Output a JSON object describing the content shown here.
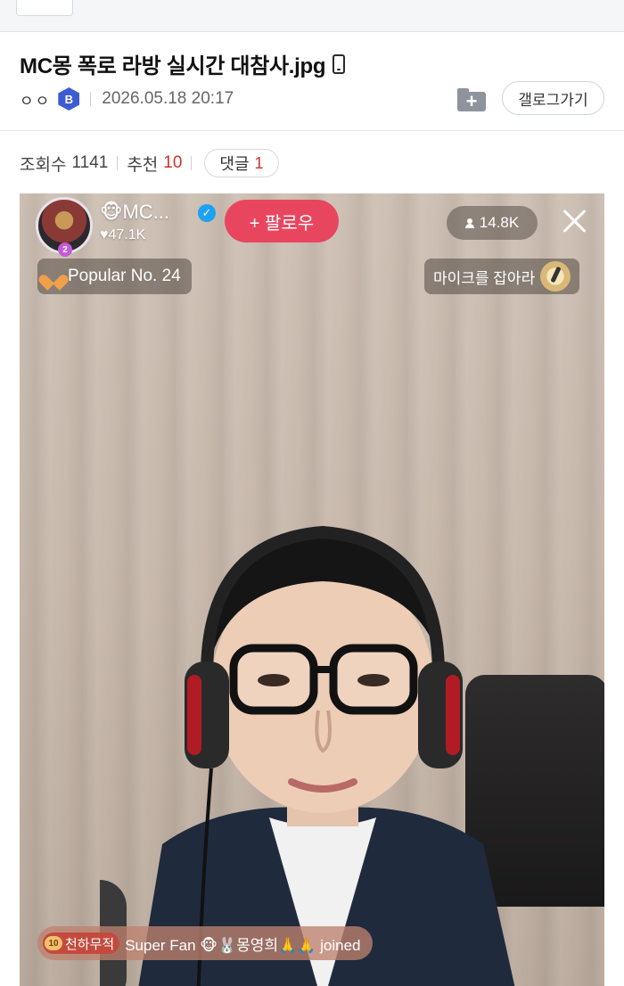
{
  "post": {
    "title": "MC몽 폭로 라방 실시간 대참사.jpg",
    "author": "ㅇㅇ",
    "author_badge": "B",
    "date": "2026.05.18 20:17",
    "gallery_button": "갤로그가기",
    "views_label": "조회수",
    "views": "1141",
    "recommend_label": "추천",
    "recommend": "10",
    "comments_label": "댓글",
    "comments": "1"
  },
  "stream": {
    "host_emoji": "🐵",
    "host_name": "MC...",
    "host_likes": "♥47.1K",
    "profile_level": "2",
    "follow_label": "+ 팔로우",
    "viewers": "14.8K",
    "popular_label": "Popular No. 24",
    "mic_event_label": "마이크를 잡아라",
    "join": {
      "badge_level": "10",
      "badge_name": "천하무적",
      "text": "Super Fan 🐵🐰몽영희🙏🙏 joined"
    }
  },
  "colors": {
    "accent_red": "#d2322d",
    "follow_pink": "#e8465f",
    "badge_blue": "#3f5bd0"
  }
}
